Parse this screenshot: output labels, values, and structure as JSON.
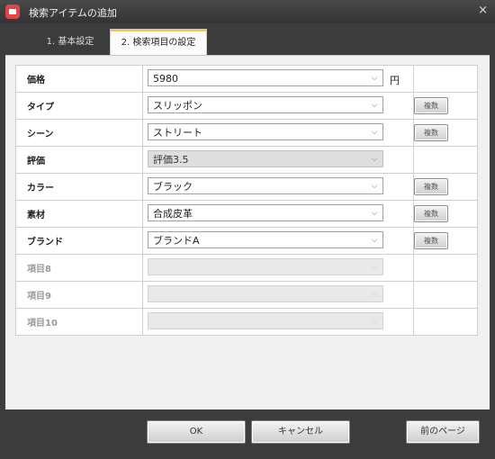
{
  "window": {
    "title": "検索アイテムの追加",
    "close_label": "×"
  },
  "tabs": [
    {
      "label": "1. 基本設定",
      "active": false
    },
    {
      "label": "2. 検索項目の設定",
      "active": true
    }
  ],
  "rows": [
    {
      "label": "価格",
      "value": "5980",
      "unit": "円",
      "state": "editable",
      "button": ""
    },
    {
      "label": "タイプ",
      "value": "スリッポン",
      "state": "editable",
      "button": "複数"
    },
    {
      "label": "シーン",
      "value": "ストリート",
      "state": "editable",
      "button": "複数"
    },
    {
      "label": "評価",
      "value": "評価3.5",
      "state": "readonly",
      "button": ""
    },
    {
      "label": "カラー",
      "value": "ブラック",
      "state": "editable",
      "button": "複数"
    },
    {
      "label": "素材",
      "value": "合成皮革",
      "state": "editable",
      "button": "複数"
    },
    {
      "label": "ブランド",
      "value": "ブランドA",
      "state": "editable",
      "button": "複数"
    },
    {
      "label": "項目8",
      "value": "",
      "state": "disabled",
      "button": ""
    },
    {
      "label": "項目9",
      "value": "",
      "state": "disabled",
      "button": ""
    },
    {
      "label": "項目10",
      "value": "",
      "state": "disabled",
      "button": ""
    }
  ],
  "buttons": {
    "ok": "OK",
    "cancel": "キャンセル",
    "prev": "前のページ"
  }
}
